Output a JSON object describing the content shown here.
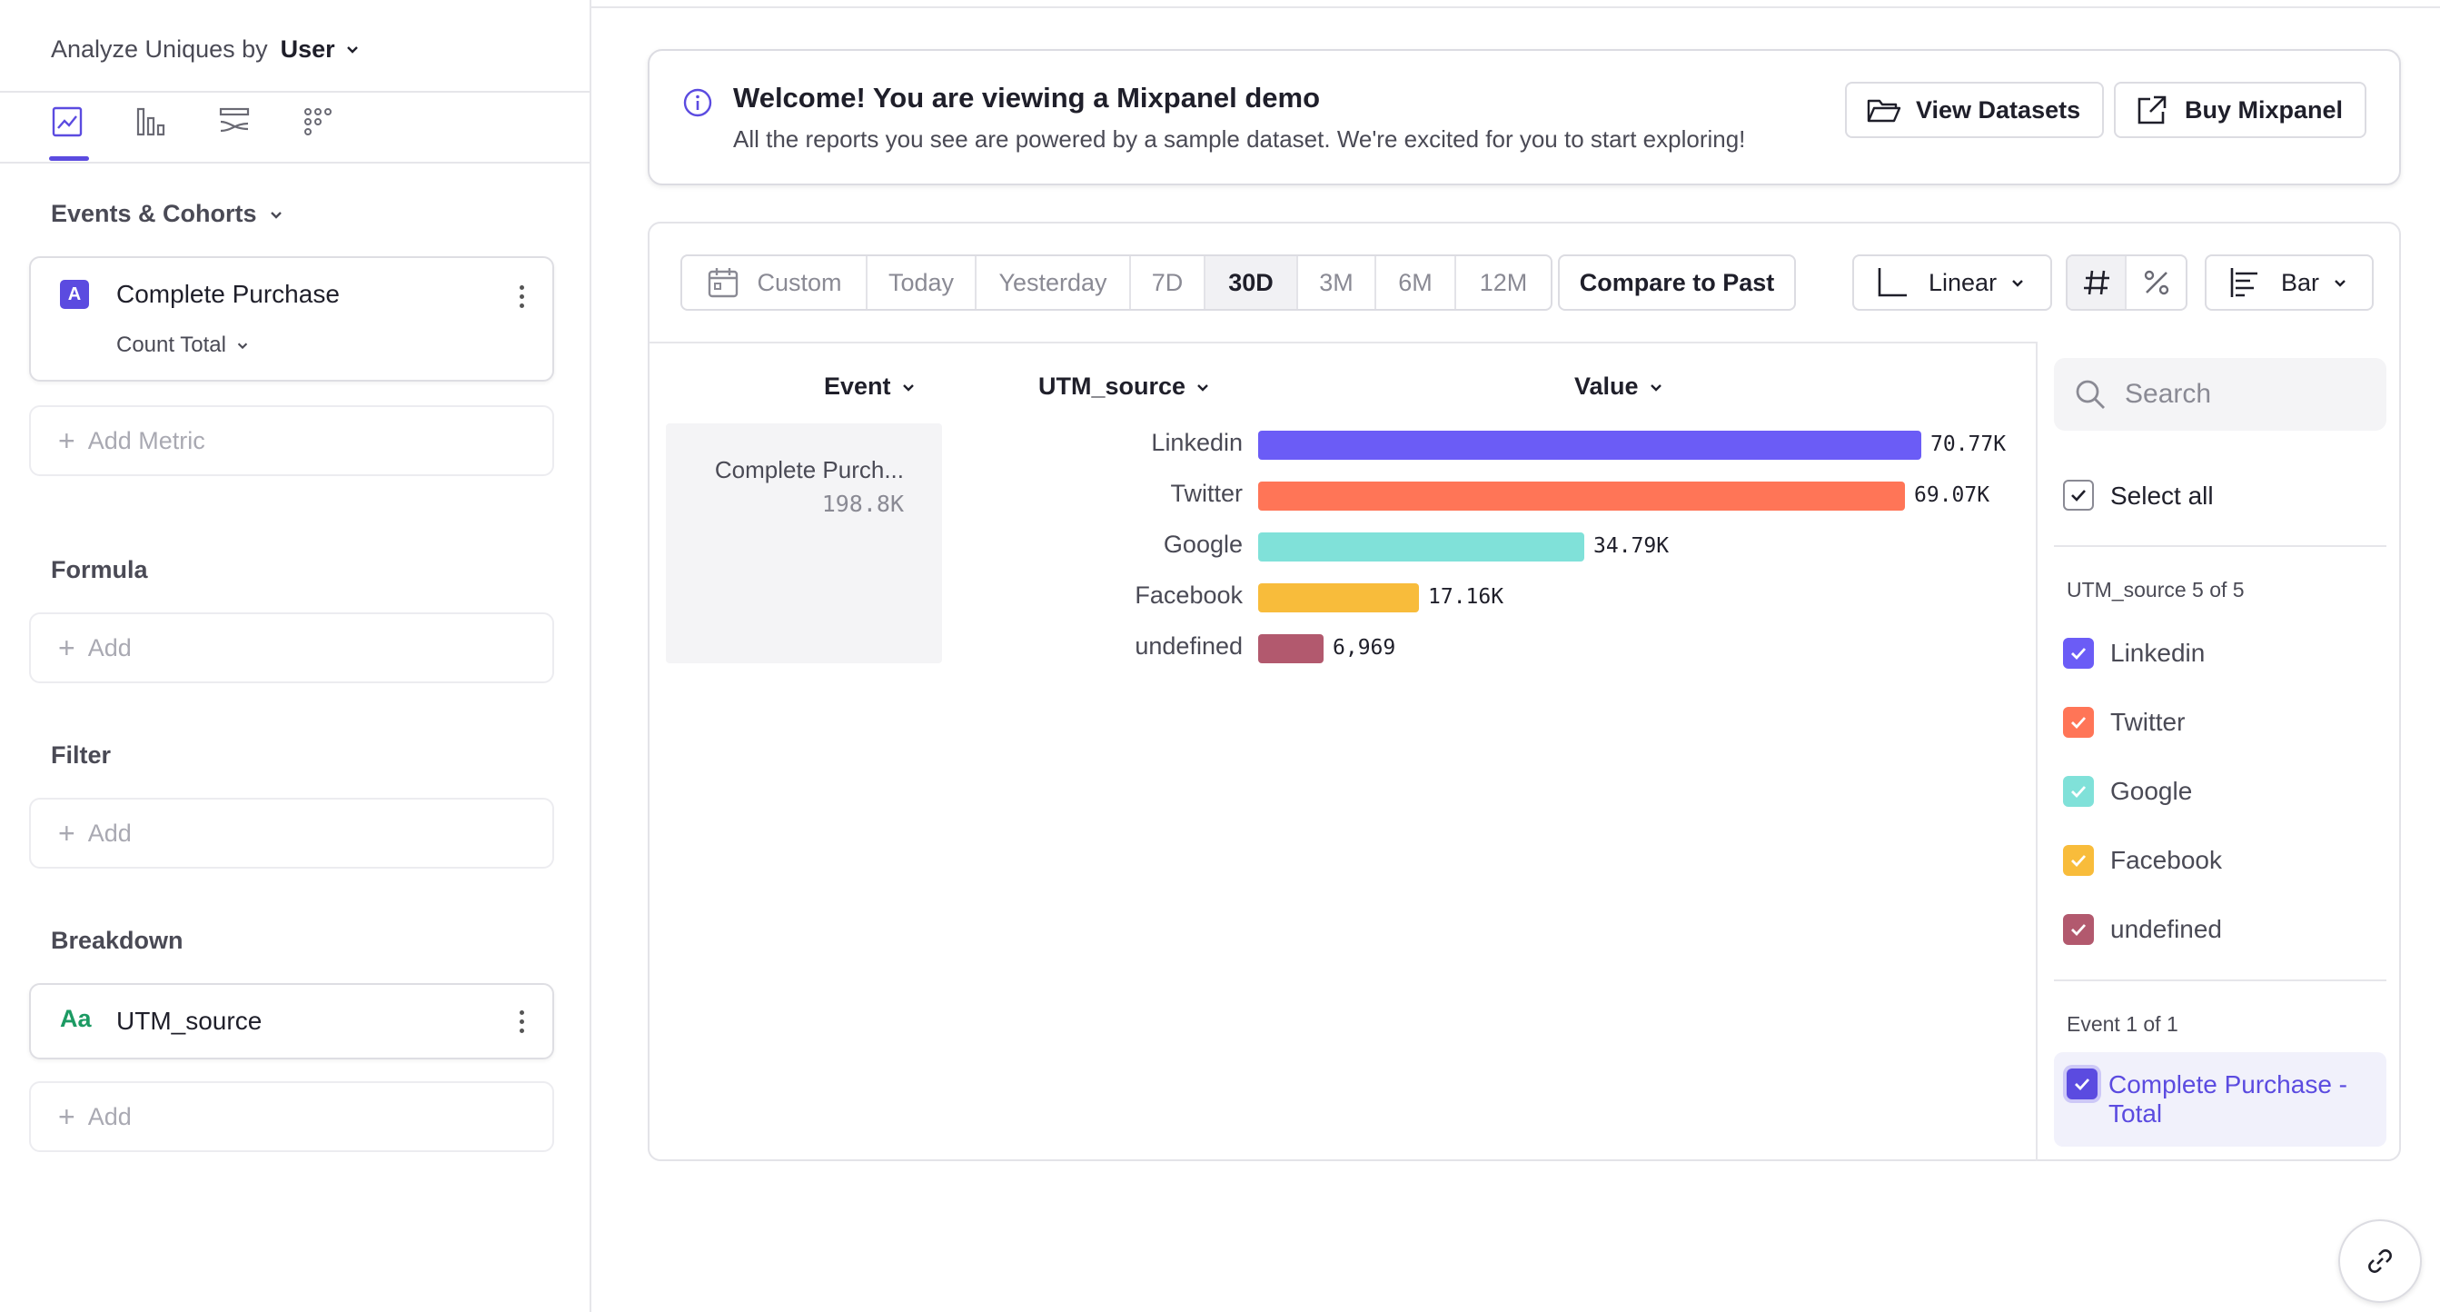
{
  "sidebar": {
    "analyze_label": "Analyze Uniques by",
    "analyze_value": "User",
    "chart_tabs": [
      "insights-line-icon",
      "bar-chart-icon",
      "flows-icon",
      "retention-grid-icon"
    ],
    "events_title": "Events & Cohorts",
    "metric": {
      "badge": "A",
      "name": "Complete Purchase",
      "measure": "Count Total"
    },
    "add_metric": "Add Metric",
    "formula_title": "Formula",
    "formula_add": "Add",
    "filter_title": "Filter",
    "filter_add": "Add",
    "breakdown_title": "Breakdown",
    "breakdown": {
      "type_icon": "Aa",
      "name": "UTM_source"
    },
    "breakdown_add": "Add"
  },
  "banner": {
    "title": "Welcome! You are viewing a Mixpanel demo",
    "subtitle": "All the reports you see are powered by a sample dataset. We're excited for you to start exploring!",
    "view_datasets": "View Datasets",
    "buy_mixpanel": "Buy Mixpanel"
  },
  "toolbar": {
    "date_ranges": [
      "Custom",
      "Today",
      "Yesterday",
      "7D",
      "30D",
      "3M",
      "6M",
      "12M"
    ],
    "active_range": "30D",
    "compare": "Compare to Past",
    "scale": "Linear",
    "chart_type": "Bar"
  },
  "table": {
    "col_event": "Event",
    "col_utm": "UTM_source",
    "col_value": "Value",
    "event_name": "Complete Purch...",
    "event_total": "198.8K"
  },
  "chart_data": {
    "type": "bar",
    "orientation": "horizontal",
    "categories": [
      "Linkedin",
      "Twitter",
      "Google",
      "Facebook",
      "undefined"
    ],
    "values": [
      70770,
      69070,
      34790,
      17160,
      6969
    ],
    "value_labels": [
      "70.77K",
      "69.07K",
      "34.79K",
      "17.16K",
      "6,969"
    ],
    "colors": [
      "#6b5cf6",
      "#ff7557",
      "#80e1d9",
      "#f8bc3b",
      "#b2596e"
    ],
    "xlabel": "",
    "ylabel": "",
    "grid": false,
    "legend": "right"
  },
  "legend": {
    "search_placeholder": "Search",
    "select_all": "Select all",
    "utm_header": "UTM_source 5 of 5",
    "items": [
      "Linkedin",
      "Twitter",
      "Google",
      "Facebook",
      "undefined"
    ],
    "event_header": "Event 1 of 1",
    "event_item": "Complete Purchase - Total"
  },
  "colors": {
    "accent": "#5b4be0"
  }
}
